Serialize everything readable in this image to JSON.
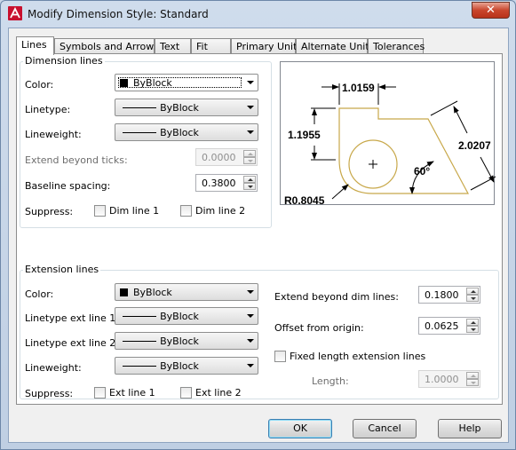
{
  "window": {
    "title": "Modify Dimension Style: Standard",
    "close_glyph": "✕"
  },
  "tabs": [
    {
      "label": "Lines",
      "active": true
    },
    {
      "label": "Symbols and Arrows"
    },
    {
      "label": "Text"
    },
    {
      "label": "Fit"
    },
    {
      "label": "Primary Units"
    },
    {
      "label": "Alternate Units"
    },
    {
      "label": "Tolerances"
    }
  ],
  "dimension_lines": {
    "title": "Dimension lines",
    "color_label": "Color:",
    "color_value": "ByBlock",
    "linetype_label": "Linetype:",
    "linetype_value": "ByBlock",
    "lineweight_label": "Lineweight:",
    "lineweight_value": "ByBlock",
    "extend_label": "Extend beyond ticks:",
    "extend_value": "0.0000",
    "baseline_label": "Baseline spacing:",
    "baseline_value": "0.3800",
    "suppress_label": "Suppress:",
    "dim1_label": "Dim line 1",
    "dim2_label": "Dim line 2"
  },
  "preview": {
    "dim_top": "1.0159",
    "dim_left": "1.1955",
    "dim_right": "2.0207",
    "angle": "60°",
    "radius": "R0.8045",
    "colors": {
      "outline": "#c8a84a",
      "dims": "#000000"
    }
  },
  "extension_lines": {
    "title": "Extension lines",
    "color_label": "Color:",
    "color_value": "ByBlock",
    "lt1_label": "Linetype ext line 1:",
    "lt1_value": "ByBlock",
    "lt2_label": "Linetype ext line 2:",
    "lt2_value": "ByBlock",
    "lineweight_label": "Lineweight:",
    "lineweight_value": "ByBlock",
    "suppress_label": "Suppress:",
    "ext1_label": "Ext line 1",
    "ext2_label": "Ext line 2",
    "extend_label": "Extend beyond dim lines:",
    "extend_value": "0.1800",
    "offset_label": "Offset from origin:",
    "offset_value": "0.0625",
    "fixed_label": "Fixed length extension lines",
    "length_label": "Length:",
    "length_value": "1.0000"
  },
  "buttons": {
    "ok": "OK",
    "cancel": "Cancel",
    "help": "Help"
  }
}
